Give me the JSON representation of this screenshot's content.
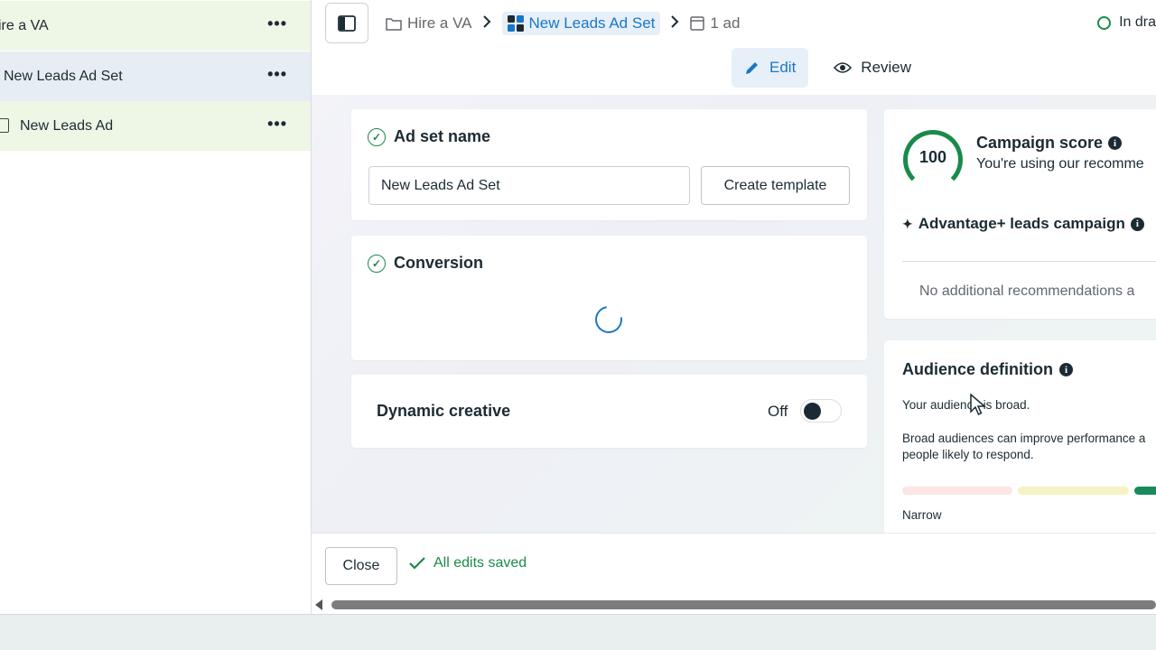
{
  "sidebar": {
    "items": [
      {
        "label": "ire a VA",
        "more": "•••"
      },
      {
        "label": "New Leads Ad Set",
        "more": "•••"
      },
      {
        "label": "New Leads Ad",
        "more": "•••"
      }
    ]
  },
  "topbar": {
    "breadcrumb": [
      {
        "label": "Hire a VA",
        "icon": "folder-icon"
      },
      {
        "label": "New Leads Ad Set",
        "icon": "grid-icon"
      },
      {
        "label": "1 ad",
        "icon": "ad-icon"
      }
    ],
    "status": "In dra",
    "tabs": [
      {
        "label": "Edit",
        "icon": "pencil-icon"
      },
      {
        "label": "Review",
        "icon": "eye-icon"
      }
    ]
  },
  "ad_set_name": {
    "title": "Ad set name",
    "input_value": "New Leads Ad Set",
    "create_template": "Create template"
  },
  "conversion": {
    "title": "Conversion"
  },
  "dynamic_creative": {
    "title": "Dynamic creative",
    "state": "Off"
  },
  "campaign_score": {
    "score": "100",
    "title": "Campaign score",
    "subtitle": "You're using our recomme",
    "advantage": "Advantage+ leads campaign",
    "no_recs": "No additional recommendations a"
  },
  "audience": {
    "title": "Audience definition",
    "line1": "Your audience is broad.",
    "line2": "Broad audiences can improve performance a",
    "line3": "people likely to respond.",
    "narrow": "Narrow"
  },
  "footer": {
    "close": "Close",
    "saved": "All edits saved"
  },
  "colors": {
    "accent_blue": "#1977c7",
    "success_green": "#1a8a4a"
  }
}
